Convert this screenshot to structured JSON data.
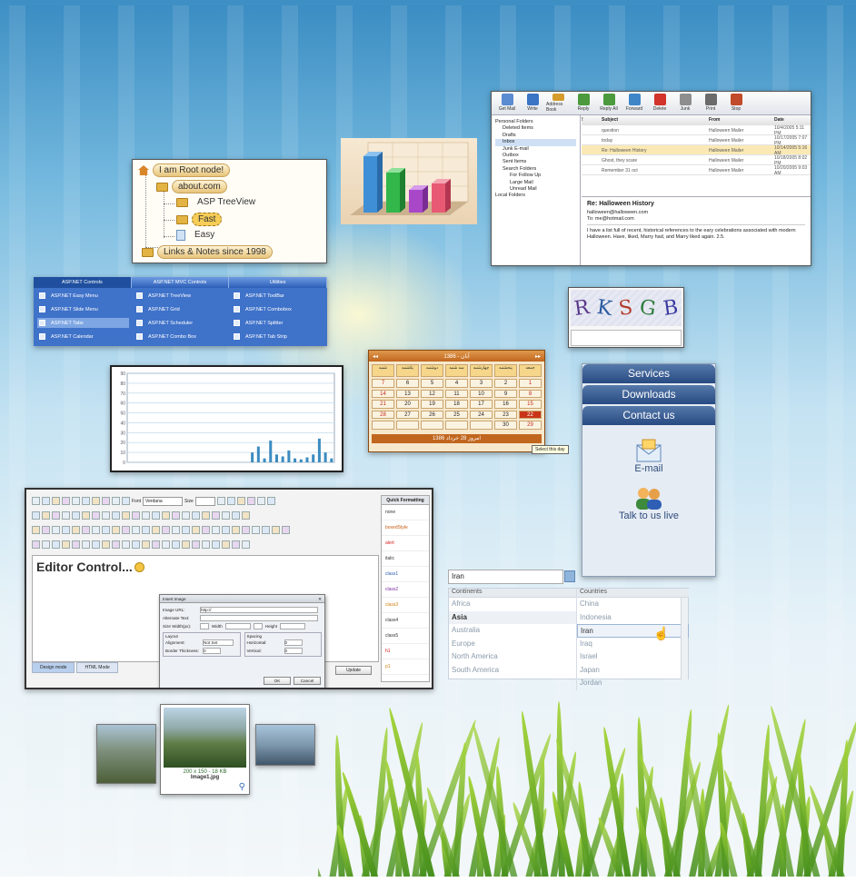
{
  "tree": {
    "root": "I am Root node!",
    "about": "about.com",
    "treeview": "ASP TreeView",
    "fast": "Fast",
    "easy": "Easy",
    "links": "Links & Notes since 1998"
  },
  "email": {
    "toolbar": [
      "Get Mail",
      "Write",
      "Address Book",
      "Reply",
      "Reply All",
      "Forward",
      "Delete",
      "Junk",
      "Print",
      "Stop"
    ],
    "folders": [
      "Personal Folders",
      "Deleted Items",
      "Drafts",
      "Inbox",
      "Junk E-mail",
      "Outbox",
      "Sent Items",
      "Search Folders",
      "For Follow Up",
      "Large Mail",
      "Unread Mail",
      "Local Folders"
    ],
    "columns": [
      "!",
      "Subject",
      "",
      "From",
      "Date"
    ],
    "rows": [
      {
        "subject": "question",
        "from": "Halloween Mailer",
        "date": "10/4/2005 5:11 PM"
      },
      {
        "subject": "today",
        "from": "Halloween Mailer",
        "date": "10/17/2005 7:07 PM"
      },
      {
        "subject": "Re: Halloween History",
        "from": "Halloween Mailer",
        "date": "10/14/2005 5:16 AM"
      },
      {
        "subject": "Ghost, they scare",
        "from": "Halloween Mailer",
        "date": "10/18/2005 8:02 PM"
      },
      {
        "subject": "Remember 31 oct",
        "from": "Halloween Mailer",
        "date": "10/20/2005 9:03 AM"
      }
    ],
    "preview_subject": "Re: Halloween History",
    "preview_from": "halloween@halloween.com",
    "preview_to": "To: me@hotmail.com",
    "preview_body": "I have a list full of recent, historical references to the eary celebrations associated with modern Halloween. Have, liked, Marry had, and Marry liked again. 2.5."
  },
  "menu": {
    "top": [
      "ASP.NET Controls",
      "ASP.NET MVC Controls",
      "Utilities"
    ],
    "col1": [
      "ASP.NET Easy Menu",
      "ASP.NET Slide Menu",
      "ASP.NET Tabs",
      "ASP.NET Calendar"
    ],
    "col2": [
      "ASP.NET TreeView",
      "ASP.NET Grid",
      "ASP.NET Scheduler",
      "ASP.NET Combo Box"
    ],
    "col3": [
      "ASP.NET ToolBar",
      "ASP.NET Combobox",
      "ASP.NET Splitter",
      "ASP.NET Tab Strip"
    ]
  },
  "captcha": {
    "letters": [
      "R",
      "K",
      "S",
      "G",
      "B"
    ]
  },
  "calendar": {
    "title": "1386 - آبان",
    "days": [
      "شنبه",
      "یکشنبه",
      "دوشنبه",
      "سه شنبه",
      "چهارشنبه",
      "پنجشنبه",
      "جمعه"
    ],
    "dates": [
      "",
      "",
      "",
      "",
      "",
      "",
      "",
      "7",
      "6",
      "5",
      "4",
      "3",
      "2",
      "1",
      "14",
      "13",
      "12",
      "11",
      "10",
      "9",
      "8",
      "21",
      "20",
      "19",
      "18",
      "17",
      "16",
      "15",
      "28",
      "27",
      "26",
      "25",
      "24",
      "23",
      "22",
      "",
      "",
      "",
      "",
      "",
      "30",
      "29"
    ],
    "footer": "امروز 28 خرداد 1386",
    "tooltip": "Select this day"
  },
  "sidenav": {
    "services": "Services",
    "downloads": "Downloads",
    "contact": "Contact us",
    "email": "E-mail",
    "talk": "Talk to us live"
  },
  "editor": {
    "font_label": "Font",
    "font_value": "Verdana",
    "size_label": "Size",
    "title": "Editor Control...",
    "tabs": [
      "Design mode",
      "HTML Mode"
    ],
    "quick_title": "Quick Formatting",
    "quick_items": [
      "none",
      "boxedStyle",
      "alert",
      "italic",
      "class1",
      "class2",
      "class3",
      "class4",
      "class5",
      "h1",
      "p1"
    ],
    "update": "Update",
    "dialog": {
      "title": "Insert Image",
      "image_url_label": "Image URL:",
      "image_url_value": "http://",
      "alt_label": "Alternate Text:",
      "size_label": "Size Width(px):",
      "width_label": "Width",
      "height_label": "Height",
      "layout_label": "Layout",
      "spacing_label": "Spacing",
      "alignment_label": "Alignment:",
      "alignment_value": "Not Set",
      "border_label": "Border Thickness:",
      "border_value": "0",
      "horizontal_label": "Horizontal:",
      "horizontal_value": "0",
      "vertical_label": "Vertical:",
      "vertical_value": "0",
      "ok": "OK",
      "cancel": "Cancel"
    }
  },
  "search": {
    "value": "Iran",
    "continents_header": "Continents",
    "countries_header": "Countries",
    "continents": [
      "Africa",
      "Asia",
      "Australia",
      "Europe",
      "North America",
      "South America"
    ],
    "countries": [
      "China",
      "Indonesia",
      "Iran",
      "Iraq",
      "Israel",
      "Japan",
      "Jordan"
    ]
  },
  "photo": {
    "size": "200 x 150 - 18 KB",
    "name": "Image1.jpg"
  },
  "chart_data": {
    "type": "bar",
    "categories": [
      "",
      "",
      "",
      "",
      "",
      "",
      "",
      "",
      "",
      "",
      "",
      "",
      "",
      "",
      "",
      "",
      "",
      "",
      "",
      "",
      "",
      "",
      "",
      "",
      "",
      "",
      "",
      "",
      "",
      "",
      "",
      "",
      "",
      ""
    ],
    "values": [
      0,
      0,
      0,
      0,
      0,
      0,
      0,
      0,
      0,
      0,
      0,
      0,
      0,
      0,
      0,
      0,
      0,
      0,
      0,
      0,
      10,
      16,
      4,
      22,
      8,
      6,
      12,
      4,
      3,
      5,
      8,
      24,
      10,
      4
    ],
    "yticks": [
      "90",
      "80",
      "70",
      "60",
      "50",
      "40",
      "30",
      "20",
      "10",
      "0"
    ],
    "ylim": [
      0,
      90
    ],
    "grid": true
  }
}
